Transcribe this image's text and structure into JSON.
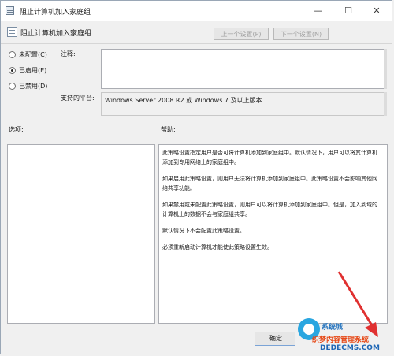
{
  "window": {
    "title": "阻止计算机加入家庭组",
    "controls": {
      "minimize": "—",
      "maximize": "☐",
      "close": "✕"
    }
  },
  "header": {
    "policy_name": "阻止计算机加入家庭组",
    "prev_button": "上一个设置(P)",
    "next_button": "下一个设置(N)"
  },
  "options": {
    "not_configured": "未配置(C)",
    "enabled": "已启用(E)",
    "disabled": "已禁用(D)",
    "selected": "enabled"
  },
  "comment": {
    "label": "注释:",
    "value": ""
  },
  "platform": {
    "label": "支持的平台:",
    "value": "Windows Server 2008 R2 或 Windows 7 及以上版本"
  },
  "panels": {
    "options_label": "选项:",
    "help_label": "帮助:"
  },
  "help_text": [
    "此策略设置指定用户是否可将计算机添加到家庭组中。默认情况下，用户可以将其计算机添加到专用网络上的家庭组中。",
    "如果启用此策略设置，则用户无法将计算机添加到家庭组中。此策略设置不会影响其他网络共享功能。",
    "如果禁用或未配置此策略设置，则用户可以将计算机添加到家庭组中。但是，加入到域的计算机上的数据不会与家庭组共享。",
    "默认情况下不会配置此策略设置。",
    "必须重新启动计算机才能使此策略设置生效。"
  ],
  "footer": {
    "ok_button": "确定"
  },
  "watermark": {
    "line1": "系统城",
    "line2": "织梦内容管理系统",
    "line3": "DEDECMS.COM"
  },
  "colors": {
    "accent": "#2aa6e0",
    "arrow": "#e03030"
  }
}
